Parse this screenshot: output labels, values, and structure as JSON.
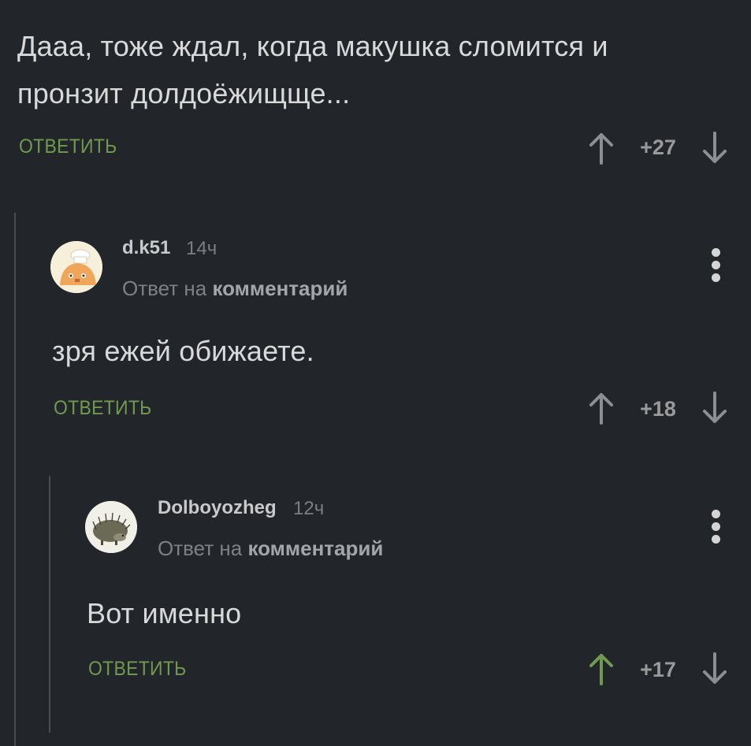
{
  "comments": [
    {
      "text_line1": "Дааа, тоже ждал, когда макушка сломится и",
      "text_line2": "пронзит долдоёжищще...",
      "reply_label": "ОТВЕТИТЬ",
      "score": "+27",
      "upvoted": false
    },
    {
      "username": "d.k51",
      "time": "14ч",
      "reply_to_prefix": "Ответ на",
      "reply_to_target": "комментарий",
      "text": "зря ежей обижаете.",
      "reply_label": "ОТВЕТИТЬ",
      "score": "+18",
      "upvoted": false
    },
    {
      "username": "Dolboyozheg",
      "time": "12ч",
      "reply_to_prefix": "Ответ на",
      "reply_to_target": "комментарий",
      "text": "Вот именно",
      "reply_label": "ОТВЕТИТЬ",
      "score": "+17",
      "upvoted": true
    }
  ],
  "colors": {
    "background": "#22262a",
    "accent_green": "#6f9a4f",
    "vote_gray": "#8c8f92",
    "text": "#d9d9d9"
  },
  "icons": {
    "upvote": "arrow-up-icon",
    "downvote": "arrow-down-icon",
    "menu": "more-vertical-icon"
  }
}
